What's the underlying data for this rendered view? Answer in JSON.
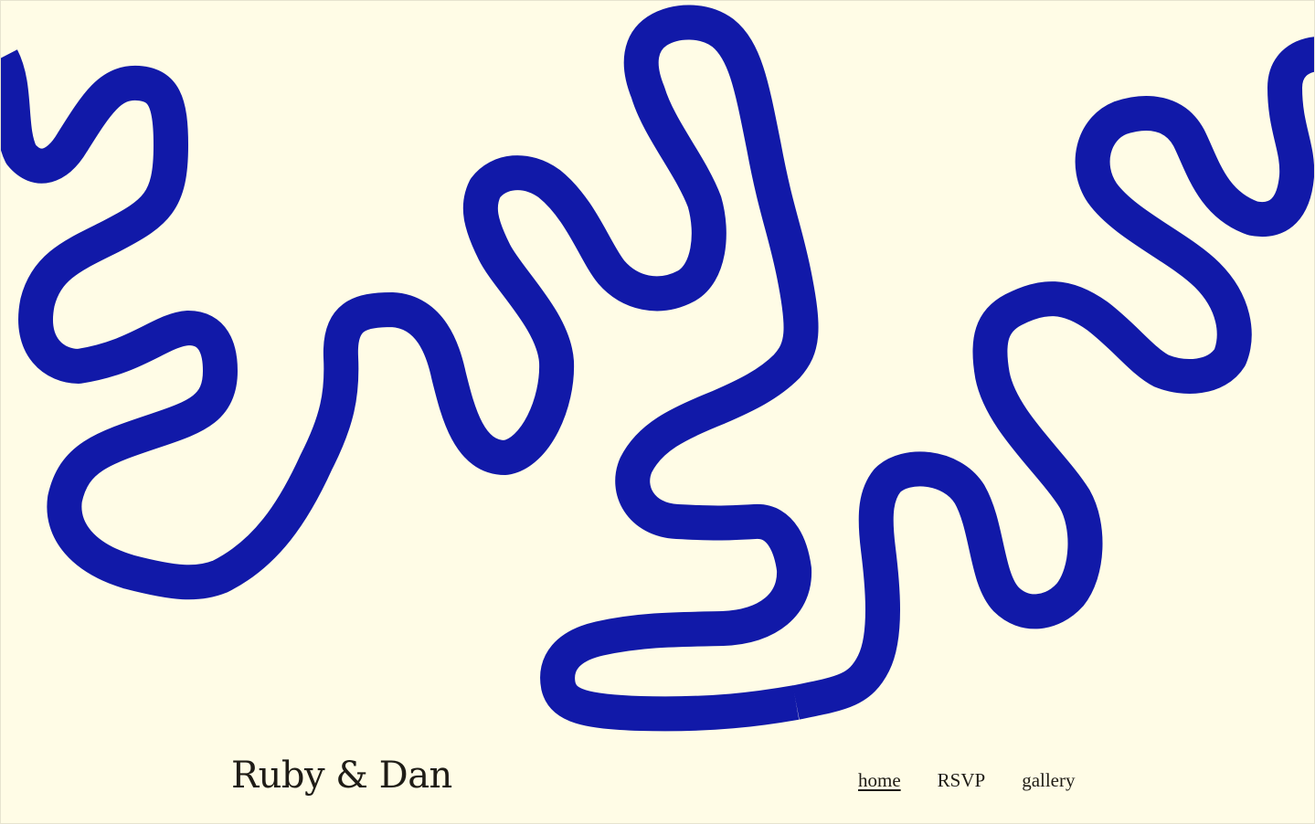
{
  "site": {
    "title": "Ruby & Dan"
  },
  "nav": {
    "items": [
      {
        "label": "home",
        "active": true
      },
      {
        "label": "RSVP",
        "active": false
      },
      {
        "label": "gallery",
        "active": false
      }
    ]
  },
  "colors": {
    "background": "#fffce6",
    "squiggle": "#1119a8",
    "text": "#1f1c16"
  }
}
